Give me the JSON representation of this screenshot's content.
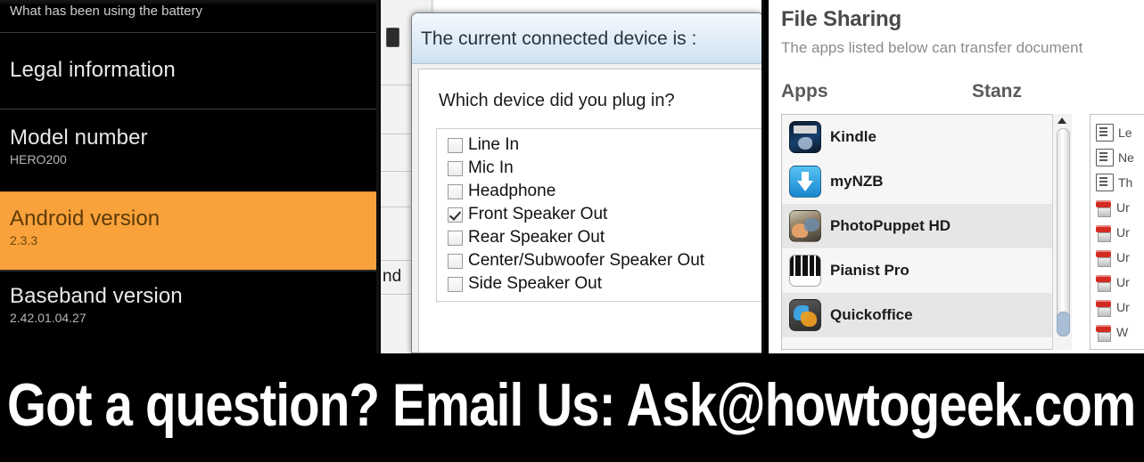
{
  "android_panel": {
    "partial_top_row": "What has been using the battery",
    "rows": [
      {
        "title": "Legal information",
        "value": "",
        "highlighted": false
      },
      {
        "title": "Model number",
        "value": "HERO200",
        "highlighted": false
      },
      {
        "title": "Android version",
        "value": "2.3.3",
        "highlighted": true
      },
      {
        "title": "Baseband version",
        "value": "2.42.01.04.27",
        "highlighted": false
      }
    ],
    "highlight_color": "#F9A13A",
    "highlight_text_color": "#5C3A07",
    "background_color": "#000000"
  },
  "device_dialog": {
    "title": "The current connected device is :",
    "question": "Which device did you plug in?",
    "background_window_fragment": "nd",
    "options": [
      {
        "label": "Line In",
        "checked": false
      },
      {
        "label": "Mic In",
        "checked": false
      },
      {
        "label": "Headphone",
        "checked": false
      },
      {
        "label": "Front Speaker Out",
        "checked": true
      },
      {
        "label": "Rear Speaker Out",
        "checked": false
      },
      {
        "label": "Center/Subwoofer Speaker Out",
        "checked": false
      },
      {
        "label": "Side Speaker Out",
        "checked": false
      }
    ]
  },
  "file_sharing": {
    "heading": "File Sharing",
    "description": "The apps listed below can transfer document",
    "apps_column_header": "Apps",
    "documents_column_header": "Stanz",
    "apps": [
      {
        "name": "Kindle",
        "icon": "kindle-app-icon"
      },
      {
        "name": "myNZB",
        "icon": "mynzb-app-icon"
      },
      {
        "name": "PhotoPuppet HD",
        "icon": "photopuppet-app-icon"
      },
      {
        "name": "Pianist Pro",
        "icon": "pianist-pro-app-icon"
      },
      {
        "name": "Quickoffice",
        "icon": "quickoffice-app-icon"
      }
    ],
    "documents": [
      {
        "label": "Le",
        "icon": "document-icon"
      },
      {
        "label": "Ne",
        "icon": "document-icon"
      },
      {
        "label": "Th",
        "icon": "document-icon"
      },
      {
        "label": "Ur",
        "icon": "pdf-icon"
      },
      {
        "label": "Ur",
        "icon": "pdf-icon"
      },
      {
        "label": "Ur",
        "icon": "pdf-icon"
      },
      {
        "label": "Ur",
        "icon": "pdf-icon"
      },
      {
        "label": "Ur",
        "icon": "pdf-icon"
      },
      {
        "label": "W",
        "icon": "pdf-icon"
      }
    ],
    "scrollbar": {
      "up_arrow": "scroll-up-arrow"
    }
  },
  "banner": {
    "text": "Got a question? Email Us: Ask@howtogeek.com"
  }
}
